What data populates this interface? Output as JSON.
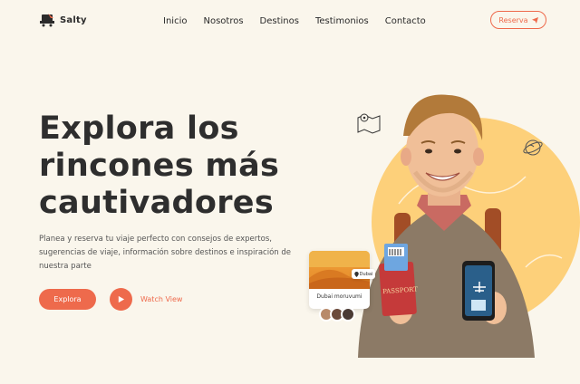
{
  "brand": {
    "name": "Salty"
  },
  "nav": {
    "items": [
      "Inicio",
      "Nosotros",
      "Destinos",
      "Testimonios",
      "Contacto"
    ],
    "cta_label": "Reserva"
  },
  "hero": {
    "headline": [
      "Explora los",
      "rincones más",
      "cautivadores"
    ],
    "subtitle": "Planea y reserva tu viaje perfecto con consejos de expertos, sugerencias de viaje, información sobre destinos e inspiración de nuestra parte",
    "primary_label": "Explora",
    "secondary_label": "Watch View"
  },
  "destination_card": {
    "caption": "Dubai moruvumi",
    "tag": "Dubai"
  },
  "passport_label": "PASSPORT",
  "icons": [
    "logo-icon",
    "send-icon",
    "play-icon",
    "map-icon",
    "globe-icon",
    "pin-icon",
    "plane-icon"
  ],
  "colors": {
    "accent": "#ee6a4c",
    "background": "#faf6ec",
    "circle": "#fdd07a"
  }
}
